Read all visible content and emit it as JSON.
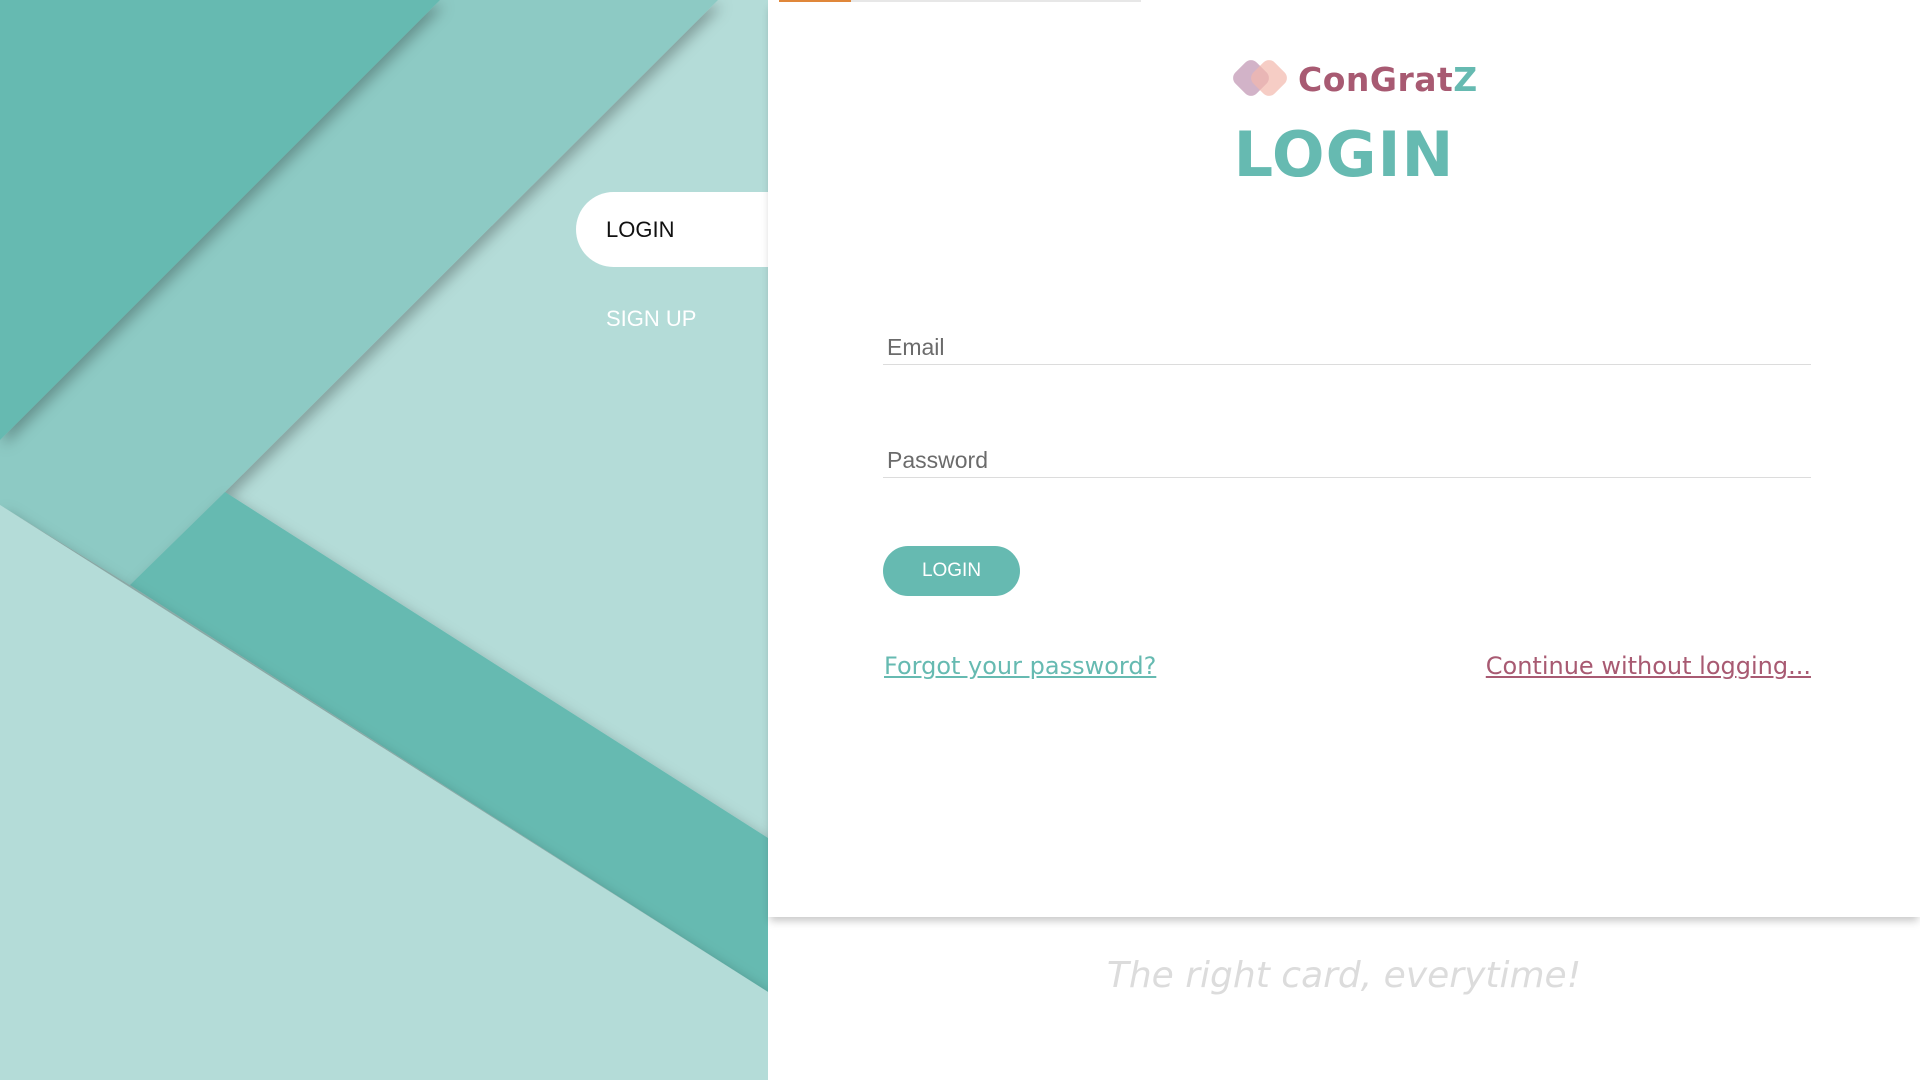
{
  "brand": {
    "name_part1": "ConGrat",
    "name_part2": "Z",
    "logo_icon": "overlapping-diamonds-logo",
    "primary_color": "#66bab1",
    "secondary_color": "#a85a72",
    "accent_color": "#e0873a"
  },
  "side_nav": {
    "tabs": [
      {
        "label": "LOGIN",
        "active": true
      },
      {
        "label": "SIGN UP",
        "active": false
      }
    ]
  },
  "form": {
    "title": "LOGIN",
    "email_placeholder": "Email",
    "password_placeholder": "Password",
    "submit_label": "LOGIN",
    "forgot_label": "Forgot your password?",
    "continue_label": "Continue without logging..."
  },
  "tagline": "The right card, everytime!"
}
